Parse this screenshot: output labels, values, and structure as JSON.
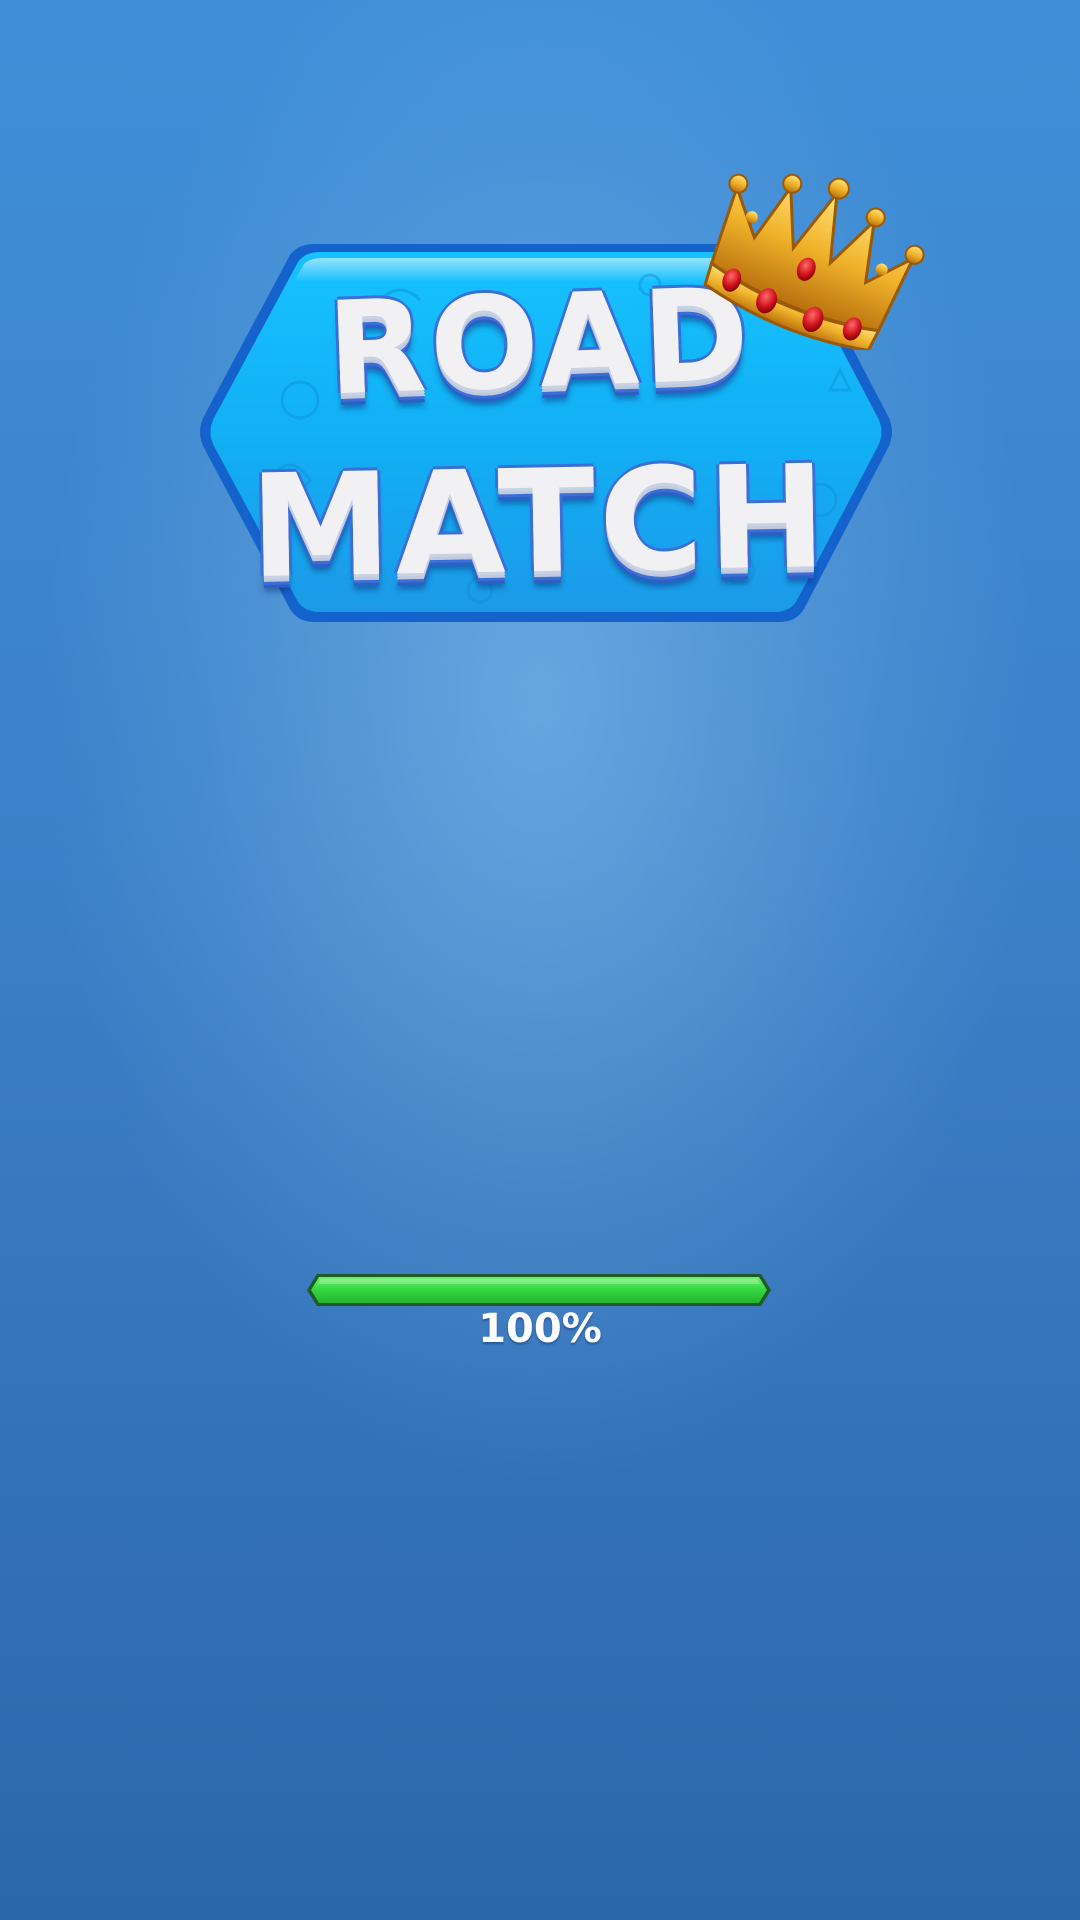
{
  "logo": {
    "line1": "ROAD",
    "line2": "MATCH",
    "plaque_color": "#12b2f6",
    "plaque_border_color": "#1768d8",
    "crown_icon": "crown-icon"
  },
  "loading": {
    "progress": 1.0,
    "percent_label": "100%",
    "bar_fill_color": "#36d642",
    "bar_border_color": "#1e5a26"
  },
  "background": {
    "top_color": "#3f8fd8",
    "bottom_color": "#2c66aa"
  }
}
